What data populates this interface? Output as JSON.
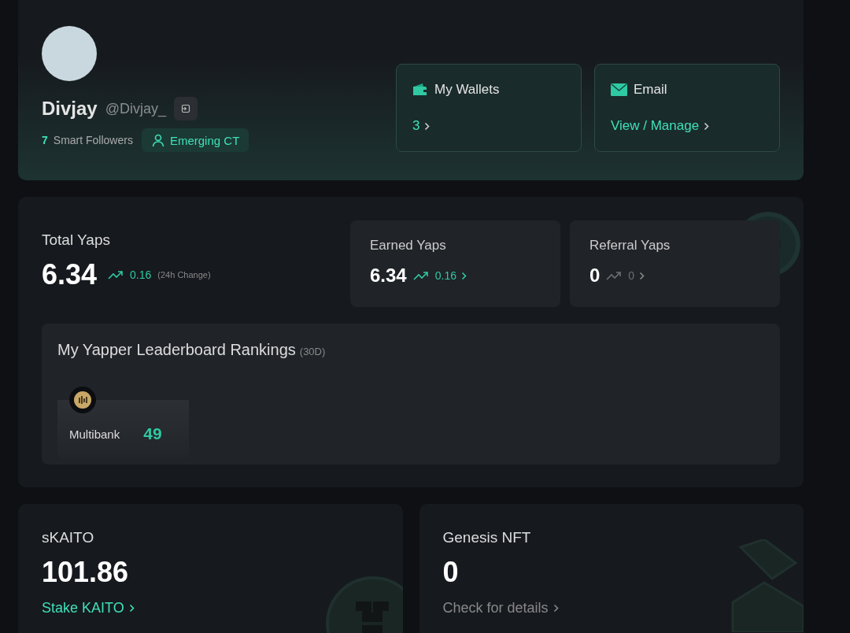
{
  "profile": {
    "name": "Divjay",
    "handle": "@Divjay_",
    "smart_followers_count": "7",
    "smart_followers_label": "Smart Followers",
    "badge": "Emerging CT"
  },
  "account_cards": [
    {
      "kind": "wallet",
      "title": "My Wallets",
      "link": "3"
    },
    {
      "kind": "email",
      "title": "Email",
      "link": "View / Manage"
    }
  ],
  "total_yaps": {
    "label": "Total Yaps",
    "value": "6.34",
    "change": "0.16",
    "change_note": "(24h Change)"
  },
  "yap_cards": [
    {
      "label": "Earned Yaps",
      "value": "6.34",
      "change": "0.16",
      "positive": true
    },
    {
      "label": "Referral Yaps",
      "value": "0",
      "change": "0",
      "positive": false
    }
  ],
  "leaderboard": {
    "title": "My Yapper Leaderboard Rankings",
    "period": "(30D)",
    "rankings": [
      {
        "project": "Multibank",
        "rank": "49"
      }
    ]
  },
  "bottom_cards": [
    {
      "kind": "coin",
      "label": "sKAITO",
      "value": "101.86",
      "link": "Stake KAITO",
      "link_active": true
    },
    {
      "kind": "box",
      "label": "Genesis NFT",
      "value": "0",
      "link": "Check for details",
      "link_active": false
    }
  ]
}
